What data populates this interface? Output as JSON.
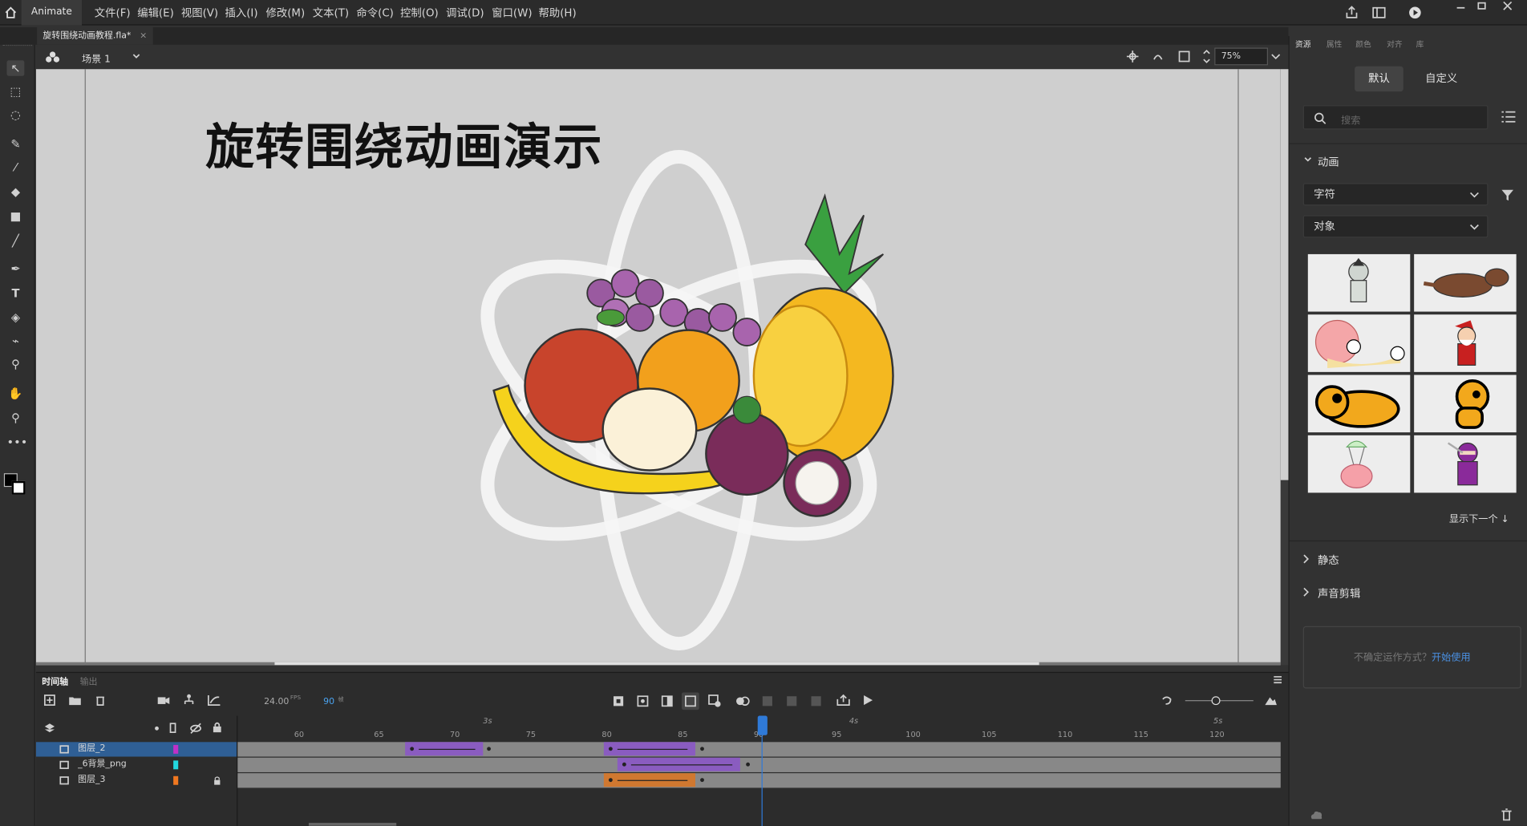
{
  "menubar": {
    "app_name": "Animate",
    "items": [
      "文件(F)",
      "编辑(E)",
      "视图(V)",
      "插入(I)",
      "修改(M)",
      "文本(T)",
      "命令(C)",
      "控制(O)",
      "调试(D)",
      "窗口(W)",
      "帮助(H)"
    ]
  },
  "document": {
    "tab_title": "旋转围绕动画教程.fla*",
    "close": "×"
  },
  "scene": {
    "label": "场景 1",
    "zoom": "75%"
  },
  "stage": {
    "title": "旋转围绕动画演示",
    "bg_color": "#cfcfcf"
  },
  "right_panel": {
    "tabs": [
      "资源",
      "属性",
      "颜色",
      "对齐",
      "库"
    ],
    "mode_tabs": [
      "默认",
      "自定义"
    ],
    "search_placeholder": "搜索",
    "section_animation": "动画",
    "dropdown_1": "字符",
    "dropdown_2": "对象",
    "show_next": "显示下一个 ↓",
    "section_static": "静态",
    "section_sound": "声音剪辑",
    "help_text": "不确定运作方式？",
    "help_link": "开始使用",
    "thumbnails": [
      "mummy-character",
      "werewolf-character",
      "snail-character",
      "santa-character",
      "dog-sleeping-character",
      "dog-sitting-character",
      "pig-parachute-character",
      "ninja-character"
    ]
  },
  "timeline": {
    "tabs": [
      "时间轴",
      "输出"
    ],
    "fps": "24.00",
    "fps_unit": "FPS",
    "frame": "90",
    "frame_unit": "帧",
    "second_markers": [
      "3s",
      "4s",
      "5s"
    ],
    "ticks": [
      "65",
      "70",
      "75",
      "80",
      "85",
      "90",
      "95",
      "100",
      "105",
      "110",
      "115",
      "120"
    ],
    "tick_60": "60",
    "layers": [
      {
        "name": "图层_2",
        "color": "#c030c8",
        "selected": true,
        "locked": false
      },
      {
        "name": "_6背景_png",
        "color": "#22d8e0",
        "selected": false,
        "locked": false
      },
      {
        "name": "图层_3",
        "color": "#f07820",
        "selected": false,
        "locked": true
      }
    ],
    "tween_colors": {
      "purple": "#8a5cc0",
      "orange": "#d07830"
    }
  }
}
